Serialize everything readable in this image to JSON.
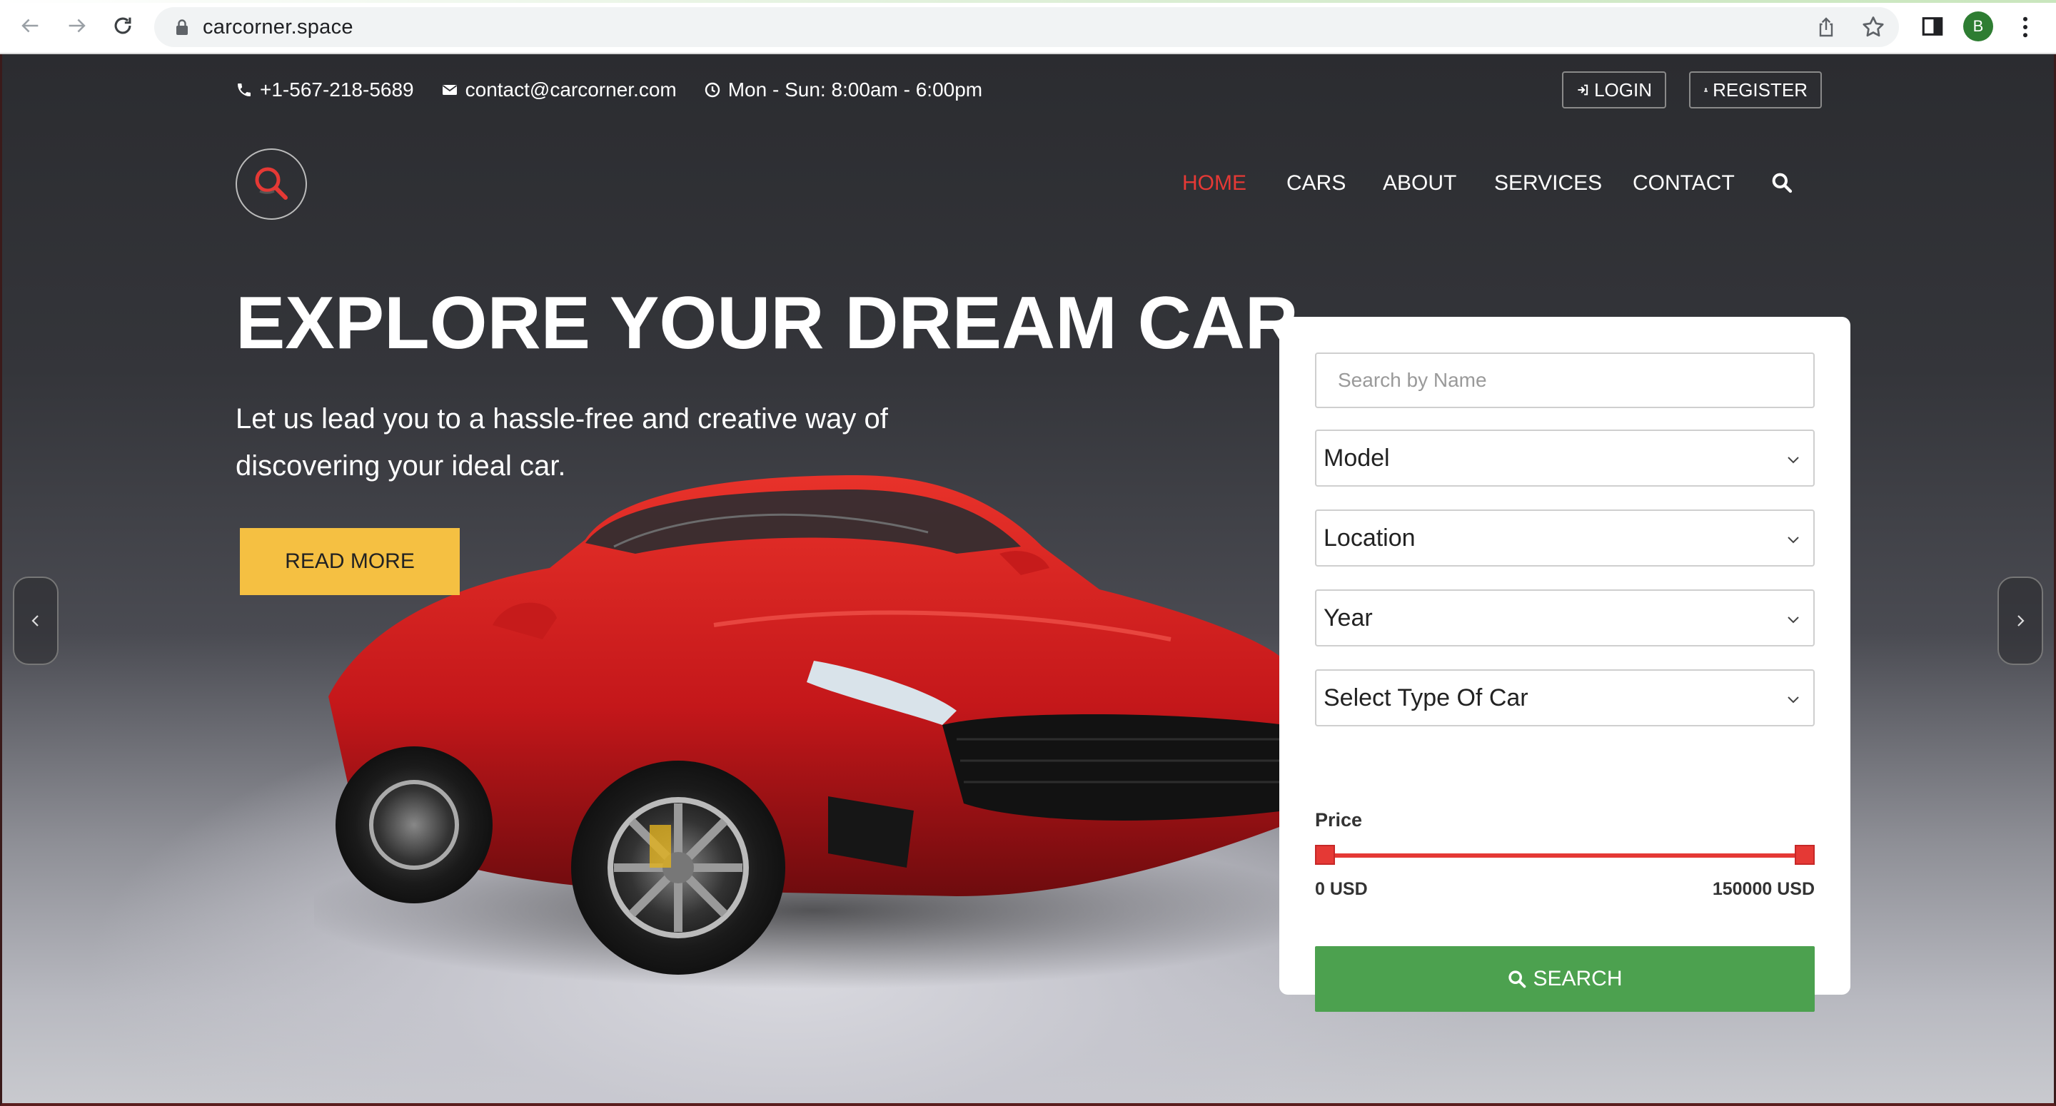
{
  "browser": {
    "url": "carcorner.space",
    "profile_initial": "B"
  },
  "topbar": {
    "phone": "+1-567-218-5689",
    "email": "contact@carcorner.com",
    "hours": "Mon - Sun: 8:00am - 6:00pm",
    "login_label": "LOGIN",
    "register_label": "REGISTER"
  },
  "nav": {
    "items": [
      {
        "label": "HOME",
        "active": true
      },
      {
        "label": "CARS",
        "active": false
      },
      {
        "label": "ABOUT",
        "active": false
      },
      {
        "label": "SERVICES",
        "active": false
      },
      {
        "label": "CONTACT",
        "active": false
      }
    ]
  },
  "hero": {
    "title": "EXPLORE YOUR DREAM CAR",
    "subtitle": "Let us lead you to a hassle-free and creative way of discovering your ideal car.",
    "cta_label": "READ MORE"
  },
  "search_panel": {
    "name_placeholder": "Search by Name",
    "model": "Model",
    "location": "Location",
    "year": "Year",
    "car_type": "Select Type Of Car",
    "price_label": "Price",
    "price_min": "0 USD",
    "price_max": "150000 USD",
    "search_label": "SEARCH"
  },
  "colors": {
    "accent_red": "#e53935",
    "cta_yellow": "#f5c042",
    "search_green": "#4ca14f"
  }
}
